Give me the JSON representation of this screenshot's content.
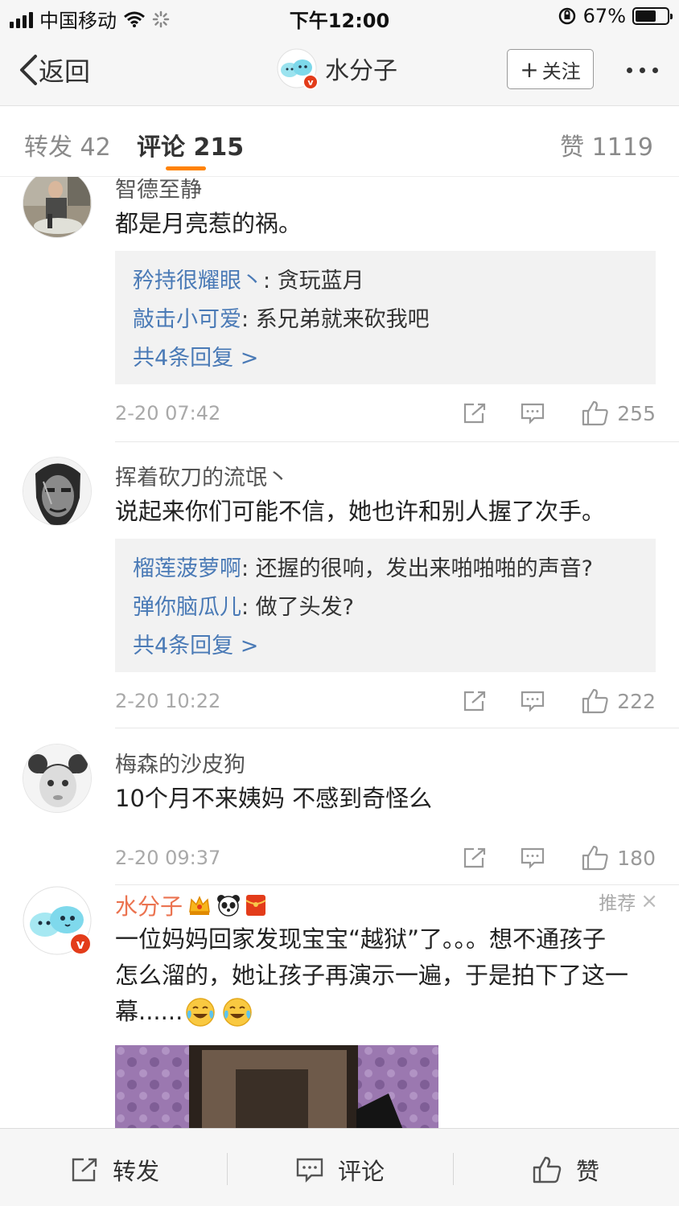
{
  "status_bar": {
    "carrier": "中国移动",
    "time": "下午12:00",
    "battery": "67%",
    "battery_level": 0.67
  },
  "nav": {
    "back_label": "返回",
    "title": "水分子",
    "follow_label": "关注"
  },
  "tabs": {
    "repost": "转发 42",
    "comment": "评论 215",
    "like": "赞 1119"
  },
  "comments": [
    {
      "username": "智德至静",
      "text": "都是月亮惹的祸。",
      "replies": [
        {
          "user": "矜持很耀眼丶",
          "text": ": 贪玩蓝月"
        },
        {
          "user": "敲击小可爱",
          "text": ": 系兄弟就来砍我吧"
        }
      ],
      "more_replies": "共4条回复 >",
      "time": "2-20 07:42",
      "likes": "255"
    },
    {
      "username": "挥着砍刀的流氓丶",
      "text": "说起来你们可能不信，她也许和别人握了次手。",
      "replies": [
        {
          "user": "榴莲菠萝啊",
          "text": ": 还握的很响，发出来啪啪啪的声音?"
        },
        {
          "user": "弹你脑瓜儿",
          "text": ": 做了头发?"
        }
      ],
      "more_replies": "共4条回复 >",
      "time": "2-20 10:22",
      "likes": "222"
    },
    {
      "username": "梅森的沙皮狗",
      "text": "10个月不来姨妈  不感到奇怪么",
      "time": "2-20 09:37",
      "likes": "180"
    }
  ],
  "promoted": {
    "username": "水分子",
    "recommend_label": "推荐",
    "text_line1": "一位妈妈回家发现宝宝“越狱”了。。。想不通孩子",
    "text_line2": "怎么溜的，她让孩子再演示一遍，于是拍下了这一",
    "text_line3": "幕......"
  },
  "bottom_bar": {
    "repost": "转发",
    "comment": "评论",
    "like": "赞"
  },
  "colors": {
    "accent": "#ff8200",
    "link": "#4a7ab6",
    "username_promoted": "#eb7350",
    "verified": "#e33c1a"
  }
}
